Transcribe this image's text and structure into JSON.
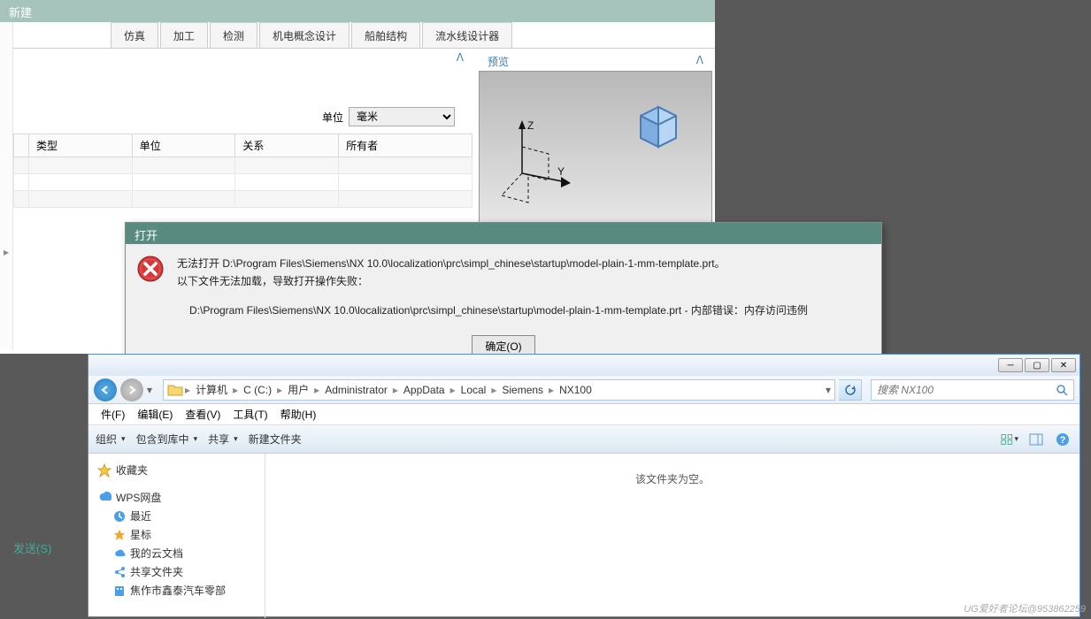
{
  "nx": {
    "title": "新建",
    "tabs": [
      "仿真",
      "加工",
      "检测",
      "机电概念设计",
      "船舶结构",
      "流水线设计器"
    ],
    "unit_label": "单位",
    "unit_value": "毫米",
    "table_headers": [
      "类型",
      "单位",
      "关系",
      "所有者"
    ],
    "preview_chevron_left": "ᐱ",
    "preview_label": "预览",
    "preview_chevron_right": "ᐱ"
  },
  "send_button": "发送(S)",
  "error": {
    "title": "打开",
    "line1": "无法打开 D:\\Program Files\\Siemens\\NX 10.0\\localization\\prc\\simpl_chinese\\startup\\model-plain-1-mm-template.prt。",
    "line2": "以下文件无法加载，导致打开操作失败：",
    "line3": "D:\\Program Files\\Siemens\\NX 10.0\\localization\\prc\\simpl_chinese\\startup\\model-plain-1-mm-template.prt - 内部错误：内存访问违例",
    "ok": "确定(O)"
  },
  "explorer": {
    "crumbs": [
      "计算机",
      "C (C:)",
      "用户",
      "Administrator",
      "AppData",
      "Local",
      "Siemens",
      "NX100"
    ],
    "search_placeholder": "搜索 NX100",
    "menu": [
      "件(F)",
      "编辑(E)",
      "查看(V)",
      "工具(T)",
      "帮助(H)"
    ],
    "toolbar": {
      "organize": "组织",
      "include": "包含到库中",
      "share": "共享",
      "newfolder": "新建文件夹"
    },
    "tree": {
      "favorites": "收藏夹",
      "wps": "WPS网盘",
      "wps_items": [
        "最近",
        "星标",
        "我的云文档",
        "共享文件夹",
        "焦作市鑫泰汽车零部"
      ]
    },
    "empty": "该文件夹为空。"
  },
  "watermark": "UG爱好者论坛@953862259"
}
